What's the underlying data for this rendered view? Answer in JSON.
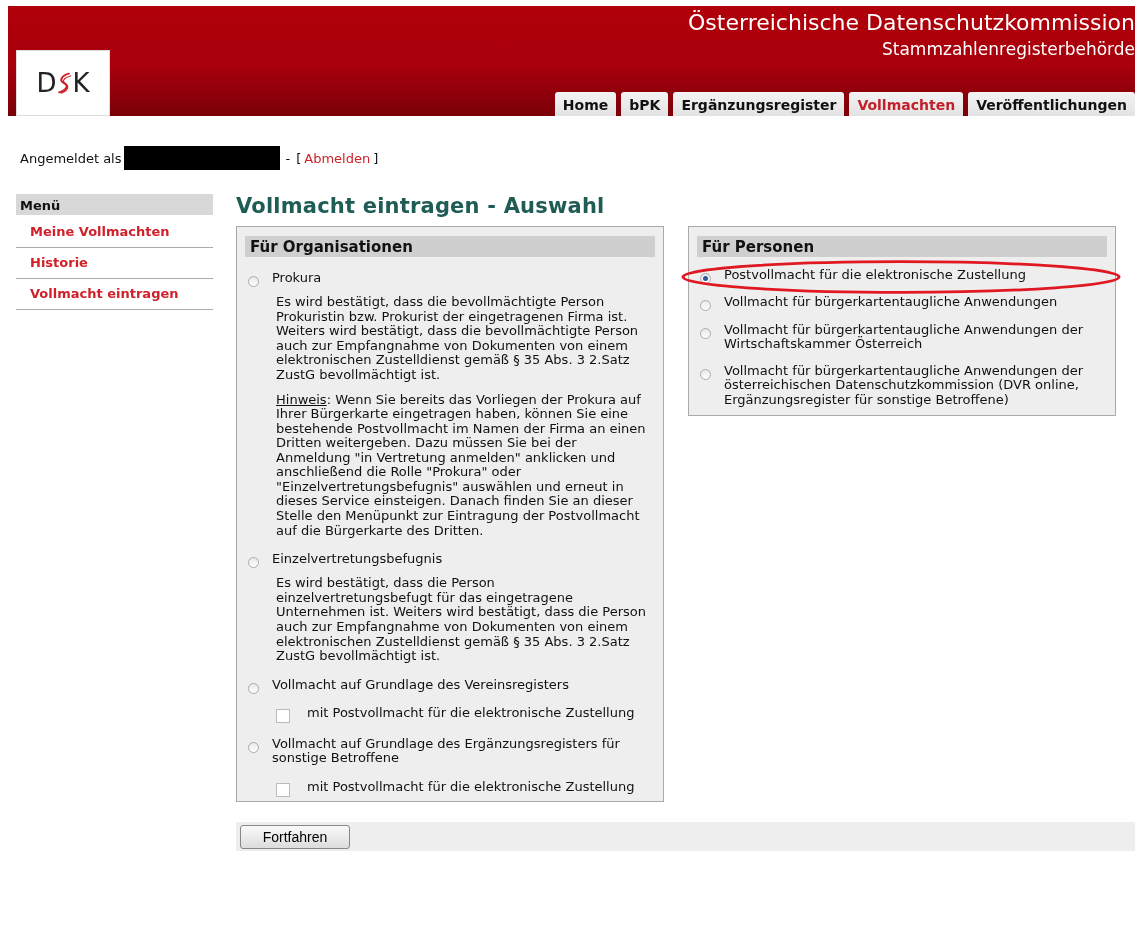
{
  "header": {
    "title": "Österreichische Datenschutzkommission",
    "subtitle": "Stammzahlenregisterbehörde",
    "logo_left": "D",
    "logo_right": "K"
  },
  "tabs": [
    {
      "label": "Home",
      "selected": false
    },
    {
      "label": "bPK",
      "selected": false
    },
    {
      "label": "Ergänzungsregister",
      "selected": false
    },
    {
      "label": "Vollmachten",
      "selected": true
    },
    {
      "label": "Veröffentlichungen",
      "selected": false
    }
  ],
  "login": {
    "label": "Angemeldet als",
    "separator": "-",
    "bracket_open": "[",
    "link": "Abmelden",
    "bracket_close": "]"
  },
  "sidebar": {
    "title": "Menü",
    "items": [
      {
        "label": "Meine Vollmachten"
      },
      {
        "label": "Historie"
      },
      {
        "label": "Vollmacht eintragen"
      }
    ]
  },
  "page_title": "Vollmacht eintragen - Auswahl",
  "organisations": {
    "title": "Für Organisationen",
    "options": [
      {
        "label": "Prokura",
        "selected": false,
        "description": [
          {
            "text": "Es wird bestätigt, dass die bevollmächtigte Person Prokuristin bzw. Prokurist der eingetragenen Firma ist. Weiters wird bestätigt, dass die bevollmächtigte Person auch zur Empfangnahme von Dokumenten von einem elektronischen Zustelldienst gemäß § 35 Abs. 3 2.Satz ZustG bevollmächtigt ist."
          },
          {
            "note_label": "Hinweis",
            "text": ": Wenn Sie bereits das Vorliegen der Prokura auf Ihrer Bürgerkarte eingetragen haben, können Sie eine bestehende Postvollmacht im Namen der Firma an einen Dritten weitergeben. Dazu müssen Sie bei der Anmeldung \"in Vertretung anmelden\" anklicken und anschließend die Rolle \"Prokura\" oder \"Einzelvertretungsbefugnis\" auswählen und erneut in dieses Service einsteigen. Danach finden Sie an dieser Stelle den Menüpunkt zur Eintragung der Postvollmacht auf die Bürgerkarte des Dritten."
          }
        ]
      },
      {
        "label": "Einzelvertretungsbefugnis",
        "selected": false,
        "description": [
          {
            "text": "Es wird bestätigt, dass die Person einzelvertretungsbefugt für das eingetragene Unternehmen ist. Weiters wird bestätigt, dass die Person auch zur Empfangnahme von Dokumenten von einem elektronischen Zustelldienst gemäß § 35 Abs. 3 2.Satz ZustG bevollmächtigt ist."
          }
        ]
      },
      {
        "label": "Vollmacht auf Grundlage des Vereinsregisters",
        "selected": false,
        "checkbox": {
          "label": "mit Postvollmacht für die elektronische Zustellung",
          "checked": false
        }
      },
      {
        "label": "Vollmacht auf Grundlage des Ergänzungsregisters für sonstige Betroffene",
        "selected": false,
        "checkbox": {
          "label": "mit Postvollmacht für die elektronische Zustellung",
          "checked": false
        }
      }
    ]
  },
  "persons": {
    "title": "Für Personen",
    "options": [
      {
        "label": "Postvollmacht für die elektronische Zustellung",
        "selected": true,
        "highlighted": true
      },
      {
        "label": "Vollmacht für bürgerkartentaugliche Anwendungen",
        "selected": false,
        "highlighted": false
      },
      {
        "label": "Vollmacht für bürgerkartentaugliche Anwendungen der Wirtschaftskammer Österreich",
        "selected": false,
        "highlighted": false
      },
      {
        "label": "Vollmacht für bürgerkartentaugliche Anwendungen der österreichischen Datenschutzkommission (DVR online, Ergänzungsregister für sonstige Betroffene)",
        "selected": false,
        "highlighted": false
      }
    ]
  },
  "button": "Fortfahren"
}
